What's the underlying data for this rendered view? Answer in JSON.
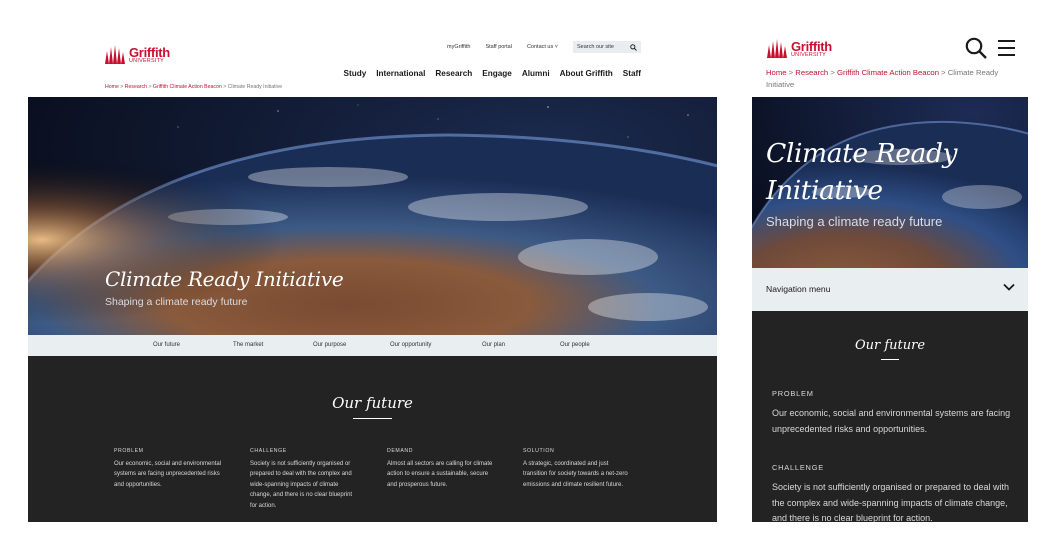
{
  "brand": {
    "name": "Griffith",
    "subname": "UNIVERSITY",
    "color": "#c8102e"
  },
  "utility_nav": {
    "my_griffith": "myGriffith",
    "staff_portal": "Staff portal",
    "contact_us": "Contact us ˅",
    "search_placeholder": "Search our site"
  },
  "main_nav": [
    "Study",
    "International",
    "Research",
    "Engage",
    "Alumni",
    "About Griffith",
    "Staff"
  ],
  "breadcrumb": {
    "home": "Home",
    "research": "Research",
    "beacon": "Griffith Climate Action Beacon",
    "current": "Climate Ready Initiative",
    "separator": ">"
  },
  "hero": {
    "title": "Climate Ready Initiative",
    "mobile_title_line1": "Climate Ready",
    "mobile_title_line2": "Initiative",
    "subtitle": "Shaping a climate ready future"
  },
  "section_tabs": [
    "Our future",
    "The market",
    "Our purpose",
    "Our opportunity",
    "Our plan",
    "Our people"
  ],
  "mobile_nav_label": "Navigation menu",
  "future": {
    "heading": "Our future",
    "columns": [
      {
        "label": "PROBLEM",
        "text": "Our economic, social and environmental systems are facing unprecedented risks and opportunities."
      },
      {
        "label": "CHALLENGE",
        "text": "Society is not sufficiently organised or prepared to deal with the complex and wide-spanning impacts of climate change, and there is no clear blueprint for action."
      },
      {
        "label": "DEMAND",
        "text": "Almost all sectors are calling for climate action to ensure a sustainable, secure and prosperous future."
      },
      {
        "label": "SOLUTION",
        "text": "A strategic, coordinated and just transition for society towards a net-zero emissions and climate resilient future."
      }
    ]
  },
  "colors": {
    "dark_section": "#232323",
    "tab_bar": "#e9eef1",
    "accent_red": "#c8102e"
  }
}
